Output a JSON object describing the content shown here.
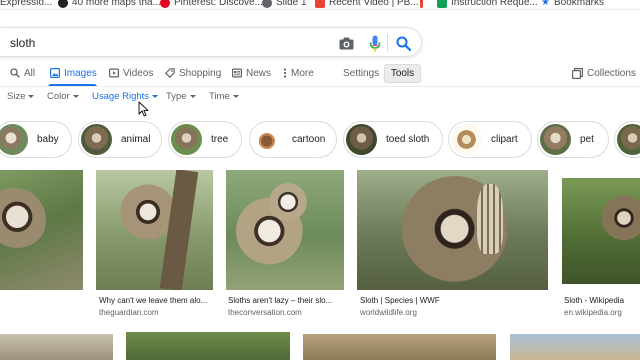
{
  "bookmarks": [
    {
      "label": "Expressio...",
      "color": "#34a853"
    },
    {
      "label": "40 more maps tha...",
      "color": "#202124"
    },
    {
      "label": "Pinterest: Discove...",
      "color": "#e60023"
    },
    {
      "label": "Slide 1",
      "color": "#5f6368"
    },
    {
      "label": "Recent Video | PB...",
      "color": "#ea4335"
    },
    {
      "label": "",
      "color": "#ea4335"
    },
    {
      "label": "Instruction Reque...",
      "color": "#0f9d58"
    },
    {
      "label": "Bookmarks",
      "color": "#1a73e8"
    }
  ],
  "search": {
    "query": "sloth"
  },
  "tabs": {
    "all": "All",
    "images": "Images",
    "videos": "Videos",
    "shopping": "Shopping",
    "news": "News",
    "more": "More",
    "settings": "Settings",
    "tools": "Tools",
    "collections": "Collections"
  },
  "filters": {
    "size": "Size",
    "color": "Color",
    "usage_rights": "Usage Rights",
    "type": "Type",
    "time": "Time"
  },
  "chips": [
    "baby",
    "animal",
    "tree",
    "cartoon",
    "toed sloth",
    "clipart",
    "pet"
  ],
  "results": [
    {
      "caption": "",
      "source": ""
    },
    {
      "caption": "Why can't we leave them alo...",
      "source": "theguardian.com"
    },
    {
      "caption": "Sloths aren't lazy – their slo...",
      "source": "theconversation.com"
    },
    {
      "caption": "Sloth | Species | WWF",
      "source": "worldwildlife.org"
    },
    {
      "caption": "Sloth - Wikipedia",
      "source": "en.wikipedia.org"
    }
  ],
  "colors": {
    "accent": "#1a73e8",
    "text": "#202124",
    "muted": "#5f6368",
    "border": "#dadce0"
  }
}
